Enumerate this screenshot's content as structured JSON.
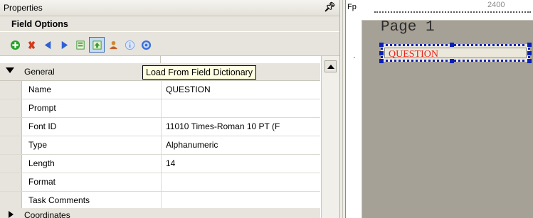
{
  "panel": {
    "title": "Properties",
    "pin_icon": "pin-icon",
    "section_title": "Field Options"
  },
  "toolbar": {
    "buttons": [
      {
        "name": "add",
        "icon": "green-plus-icon",
        "color": "#27a22a"
      },
      {
        "name": "delete",
        "icon": "red-x-icon",
        "color": "#d23b1c"
      },
      {
        "name": "previous",
        "icon": "blue-left-arrow-icon",
        "color": "#2d5fd6"
      },
      {
        "name": "next",
        "icon": "blue-right-arrow-icon",
        "color": "#2d5fd6"
      },
      {
        "name": "save-to-dictionary",
        "icon": "book-green-icon",
        "color": "#3c9a3c"
      },
      {
        "name": "load-from-field-dictionary",
        "icon": "book-up-arrow-icon",
        "color": "#3c9a3c",
        "active": true
      },
      {
        "name": "users",
        "icon": "users-icon",
        "color": "#d08a2a"
      },
      {
        "name": "info",
        "icon": "info-icon",
        "color": "#7aa0e6"
      },
      {
        "name": "help",
        "icon": "help-icon",
        "color": "#3a6fd8"
      }
    ]
  },
  "tooltip": {
    "text": "Load From Field Dictionary"
  },
  "grid": {
    "category": "General",
    "rows": [
      {
        "name": "Name",
        "value": "QUESTION"
      },
      {
        "name": "Prompt",
        "value": ""
      },
      {
        "name": "Font ID",
        "value": "11010 Times-Roman 10 PT (F"
      },
      {
        "name": "Type",
        "value": "Alphanumeric"
      },
      {
        "name": "Length",
        "value": "14"
      },
      {
        "name": "Format",
        "value": ""
      },
      {
        "name": "Task Comments",
        "value": ""
      }
    ],
    "next_category": "Coordinates"
  },
  "canvas": {
    "fp_label": "Fp",
    "ruler_number": "2400",
    "page_label": "Page 1",
    "field_text": "QUESTION",
    "field_text_color": "#e8231a",
    "selection_color": "#0b1fb8"
  }
}
